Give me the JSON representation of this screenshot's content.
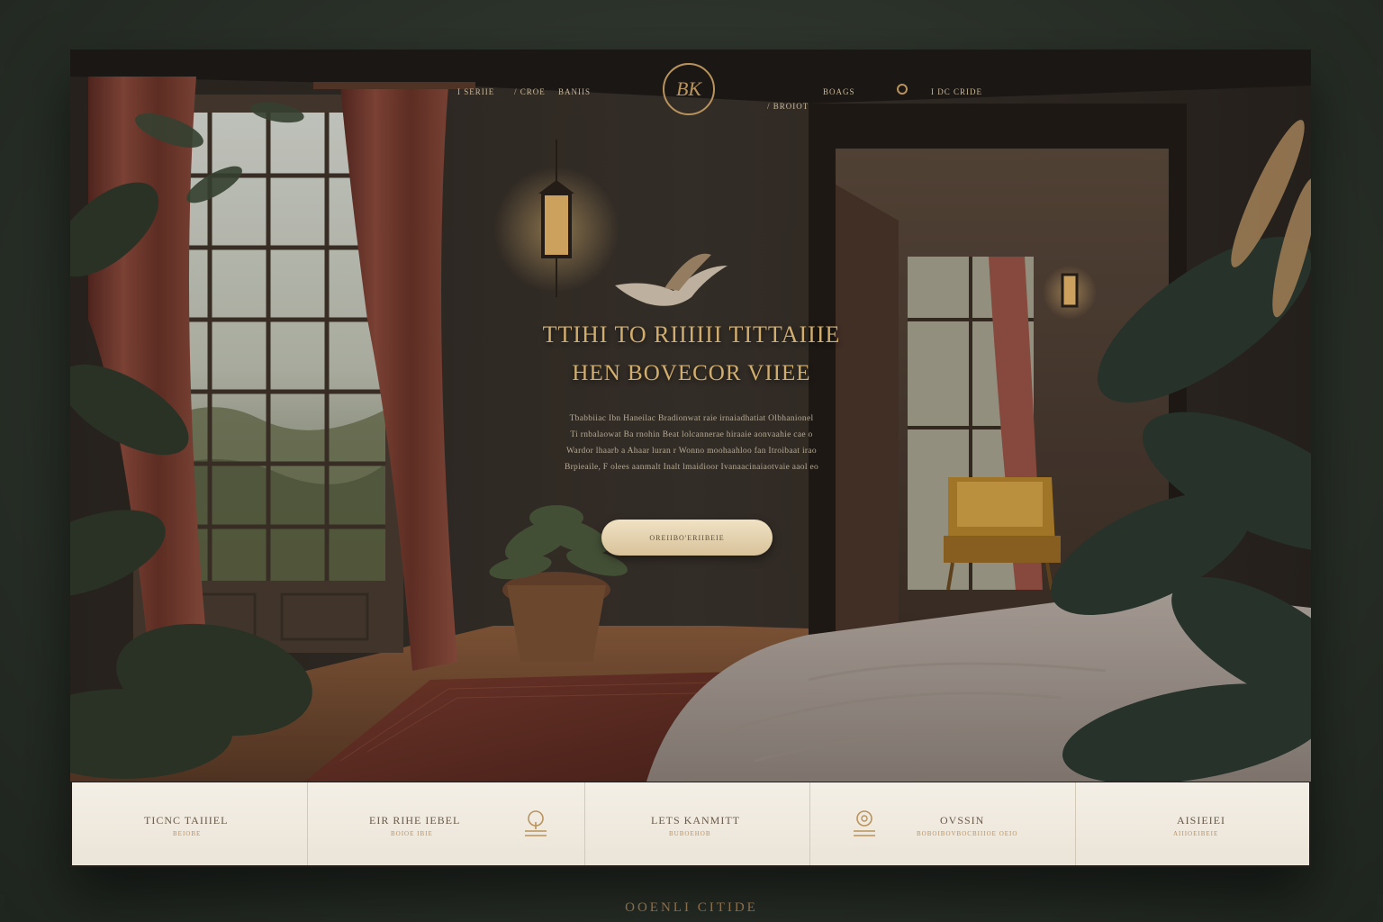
{
  "nav": {
    "left_links": [
      "I SERIIE",
      "/ CROE",
      "BANIIS"
    ],
    "logo_text": "BK",
    "right_links": [
      "BOAGS",
      "I DC CRIDE"
    ],
    "sub_link": "/ BROIOT"
  },
  "hero": {
    "headline_line1": "TTIHI TO RIIIIII TITTAIIIE",
    "headline_line2": "HEN BOVECOR  VIIEE",
    "body_lines": [
      "Tbabbiiac Ibn Haneilac Bradionwat raie irnaiadhatiat Olbhanionel",
      "Ti rnbalaowat Ba rnohin Beat lolcannerae hiraaie aonvaahie cae o",
      "Wardor lhaarb a Ahaar luran r Wonno moohaahloo fan Itroibaat irao",
      "Brpieaile, F olees aanmalt Inalt lmaidioor Ivanaacinaiaotvaie aaol eo"
    ],
    "cta_label": "OREIIBO'ERIIBEIE"
  },
  "features": [
    {
      "title": "TICNC TAIIIEL",
      "subtitle": "BEIOBE",
      "icon": "none"
    },
    {
      "title": "EIR RIHE IEBEL",
      "subtitle": "BOIOE IBIE",
      "icon": "tree-icon"
    },
    {
      "title": "LETS KANMITT",
      "subtitle": "BUBOEHOB",
      "icon": "none"
    },
    {
      "title": "OVSSIN",
      "subtitle": "BOBOIBOVBOCBIIIOE OEIO",
      "icon": "wreath-icon"
    },
    {
      "title": "AISIEIEI",
      "subtitle": "AIIIOEIBEIE",
      "icon": "none"
    }
  ],
  "footer": {
    "title": "OOENLI  CITIDE"
  },
  "colors": {
    "accent_gold": "#d1ad6e",
    "band_bg": "#f0eadf",
    "cta_bg": "#e6d4b0",
    "backdrop": "#2a3129"
  }
}
